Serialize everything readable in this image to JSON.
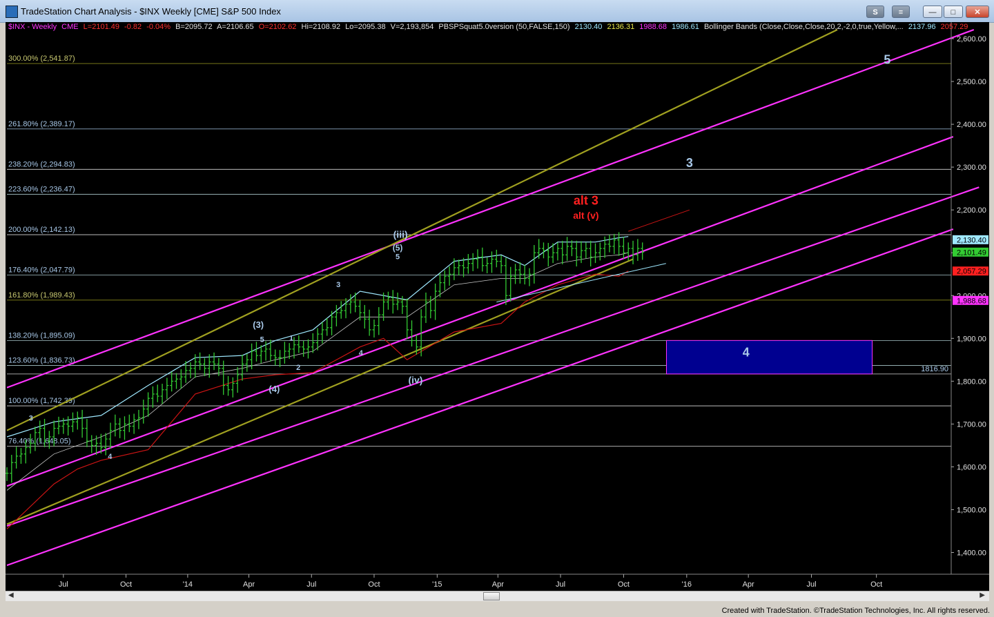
{
  "window": {
    "title": "TradeStation Chart Analysis - $INX Weekly [CME] S&P 500 Index",
    "btn_s": "S",
    "btn_menu": "≡",
    "btn_min": "—",
    "btn_max": "□",
    "btn_close": "✕"
  },
  "legend": {
    "symbol": "$INX - Weekly",
    "exchange": "CME",
    "last": "L=2101.49",
    "change": "-0.82",
    "change_pct": "-0.04%",
    "bid": "B=2095.72",
    "ask": "A=2106.65",
    "open": "O=2102.62",
    "high": "Hi=2108.92",
    "low": "Lo=2095.38",
    "volume": "V=2,193,854",
    "indicator1": "PBSPSquat5.0version (50,FALSE,150)",
    "ind1_v1": "2130.40",
    "ind1_v2": "2136.31",
    "ind1_v3": "1988.68",
    "ind1_v4": "1986.61",
    "indicator2": "Bollinger Bands (Close,Close,Close,20,2,-2,0,true,Yellow,...",
    "ind2_v1": "2137.96",
    "ind2_v2": "2057.29"
  },
  "colors": {
    "price_bars": "#33cc33",
    "magenta_channel": "#ff33ff",
    "olive_channel": "#a0a020",
    "fib_lines": "#c8ecf0",
    "wave_labels": "#a8c8e8",
    "alt_labels": "#ff2020",
    "box_fill": "#000090",
    "boll_upper": "#9fe8ff",
    "boll_mid": "#c8c8c8",
    "boll_lower": "#cc1414"
  },
  "chart_data": {
    "type": "ohlc",
    "title": "$INX Weekly [CME] S&P 500 Index",
    "y_axis_ticks": [
      "2,600.00",
      "2,500.00",
      "2,400.00",
      "2,300.00",
      "2,200.00",
      "2,100.00",
      "2,000.00",
      "1,900.00",
      "1,800.00",
      "1,700.00",
      "1,600.00",
      "1,500.00",
      "1,400.00"
    ],
    "x_axis_ticks": [
      "Jul",
      "Oct",
      "'14",
      "Apr",
      "Jul",
      "Oct",
      "'15",
      "Apr",
      "Jul",
      "Oct",
      "'16",
      "Apr",
      "Jul",
      "Oct"
    ],
    "ylim": [
      1380,
      2630
    ],
    "fib_levels": [
      {
        "label": "300.00% (2,541.87)",
        "value": 2541.87
      },
      {
        "label": "261.80% (2,389.17)",
        "value": 2389.17
      },
      {
        "label": "238.20% (2,294.83)",
        "value": 2294.83
      },
      {
        "label": "223.60% (2,236.47)",
        "value": 2236.47
      },
      {
        "label": "200.00% (2,142.13)",
        "value": 2142.13
      },
      {
        "label": "176.40% (2,047.79)",
        "value": 2047.79
      },
      {
        "label": "161.80% (1,989.43)",
        "value": 1989.43
      },
      {
        "label": "138.20% (1,895.09)",
        "value": 1895.09
      },
      {
        "label": "123.60% (1,836.73)",
        "value": 1836.73
      },
      {
        "label": "100.00% (1,742.39)",
        "value": 1742.39
      },
      {
        "label": "76.40% (1,648.05)",
        "value": 1648.05
      }
    ],
    "extra_level": {
      "label": "1816.90",
      "value": 1816.9
    },
    "right_axis_badges": [
      {
        "label": "2,130.40",
        "value": 2130.4,
        "color": "#9fe8ff"
      },
      {
        "label": "2,101.49",
        "value": 2101.49,
        "color": "#33cc33"
      },
      {
        "label": "2,057.29",
        "value": 2057.29,
        "color": "#ff2020"
      },
      {
        "label": "1,988.68",
        "value": 1988.68,
        "color": "#ff33ff"
      }
    ],
    "wave_labels": [
      {
        "text": "5",
        "x_week": 187,
        "y": 2541,
        "size": 18,
        "color": "#a8c8e8"
      },
      {
        "text": "3",
        "x_week": 145,
        "y": 2300,
        "size": 18,
        "color": "#a8c8e8"
      },
      {
        "text": "alt 3",
        "x_week": 123,
        "y": 2212,
        "size": 18,
        "color": "#ff2020"
      },
      {
        "text": "alt (v)",
        "x_week": 123,
        "y": 2179,
        "size": 14,
        "color": "#ff2020"
      },
      {
        "text": "(iii)",
        "x_week": 83.6,
        "y": 2135,
        "size": 14,
        "color": "#a8c8e8"
      },
      {
        "text": "(5)",
        "x_week": 83,
        "y": 2105,
        "size": 12,
        "color": "#a8c8e8"
      },
      {
        "text": "5",
        "x_week": 83,
        "y": 2085,
        "size": 11,
        "color": "#a8c8e8"
      },
      {
        "text": "3",
        "x_week": 70.4,
        "y": 2020,
        "size": 11,
        "color": "#a8c8e8"
      },
      {
        "text": "(3)",
        "x_week": 53.4,
        "y": 1925,
        "size": 13,
        "color": "#a8c8e8"
      },
      {
        "text": "5",
        "x_week": 54.2,
        "y": 1892,
        "size": 11,
        "color": "#a8c8e8"
      },
      {
        "text": "1",
        "x_week": 60.4,
        "y": 1895,
        "size": 11,
        "color": "#a8c8e8"
      },
      {
        "text": "4",
        "x_week": 75.2,
        "y": 1860,
        "size": 11,
        "color": "#a8c8e8"
      },
      {
        "text": "2",
        "x_week": 61.9,
        "y": 1826,
        "size": 11,
        "color": "#a8c8e8"
      },
      {
        "text": "(4)",
        "x_week": 56.8,
        "y": 1775,
        "size": 13,
        "color": "#a8c8e8"
      },
      {
        "text": "(iv)",
        "x_week": 86.8,
        "y": 1795,
        "size": 14,
        "color": "#a8c8e8"
      },
      {
        "text": "3",
        "x_week": 5.1,
        "y": 1708,
        "size": 11,
        "color": "#a8c8e8"
      },
      {
        "text": "4",
        "x_week": 21.9,
        "y": 1618,
        "size": 11,
        "color": "#a8c8e8"
      },
      {
        "text": "4",
        "x_week": 157,
        "y": 1858,
        "size": 18,
        "color": "#a8c8e8"
      }
    ],
    "target_box": {
      "x0_week": 140.1,
      "x1_week": 183.8,
      "y_top": 1895.09,
      "y_bottom": 1816.9
    },
    "channels": [
      {
        "color": "#ff33ff",
        "x0_week": 0,
        "y0": 1785,
        "x1_week": 205.4,
        "y1": 2621
      },
      {
        "color": "#ff33ff",
        "x0_week": 0,
        "y0": 1555,
        "x1_week": 201,
        "y1": 2371
      },
      {
        "color": "#ff33ff",
        "x0_week": 0,
        "y0": 1462,
        "x1_week": 206.5,
        "y1": 2253
      },
      {
        "color": "#ff33ff",
        "x0_week": 0,
        "y0": 1370,
        "x1_week": 201,
        "y1": 2155
      },
      {
        "color": "#a0a020",
        "x0_week": 0,
        "y0": 1685,
        "x1_week": 176.4,
        "y1": 2621
      },
      {
        "color": "#a0a020",
        "x0_week": 0,
        "y0": 1466,
        "x1_week": 133,
        "y1": 2085
      }
    ],
    "bars_weekly": {
      "start_week": 0,
      "closes": [
        1585,
        1610,
        1625,
        1630,
        1645,
        1655,
        1680,
        1690,
        1660,
        1670,
        1690,
        1695,
        1700,
        1695,
        1705,
        1715,
        1690,
        1660,
        1650,
        1655,
        1645,
        1665,
        1685,
        1700,
        1685,
        1700,
        1695,
        1710,
        1715,
        1735,
        1760,
        1770,
        1765,
        1780,
        1790,
        1800,
        1805,
        1810,
        1825,
        1830,
        1845,
        1840,
        1830,
        1845,
        1840,
        1830,
        1790,
        1780,
        1795,
        1815,
        1840,
        1850,
        1870,
        1860,
        1870,
        1875,
        1860,
        1855,
        1855,
        1870,
        1875,
        1885,
        1880,
        1875,
        1880,
        1890,
        1910,
        1920,
        1925,
        1950,
        1960,
        1965,
        1980,
        1985,
        1975,
        1960,
        1945,
        1920,
        1930,
        1955,
        1985,
        1995,
        1980,
        1985,
        1975,
        1920,
        1895,
        1880,
        1950,
        1985,
        1965,
        2010,
        2030,
        2045,
        2050,
        2065,
        2070,
        2065,
        2075,
        2085,
        2090,
        2070,
        2075,
        2085,
        2080,
        2070,
        2000,
        2045,
        2060,
        2050,
        2040,
        2050,
        2100,
        2110,
        2105,
        2090,
        2100,
        2110,
        2095,
        2115,
        2110,
        2090,
        2105,
        2110,
        2090,
        2100,
        2110,
        2120,
        2115,
        2130,
        2115,
        2100,
        2110,
        2095,
        2110,
        2101.49
      ]
    },
    "bollinger": {
      "upper_knots": [
        [
          0,
          1670
        ],
        [
          10,
          1705
        ],
        [
          20,
          1720
        ],
        [
          30,
          1790
        ],
        [
          40,
          1855
        ],
        [
          50,
          1860
        ],
        [
          57,
          1895
        ],
        [
          65,
          1920
        ],
        [
          75,
          2010
        ],
        [
          85,
          1990
        ],
        [
          95,
          2080
        ],
        [
          105,
          2095
        ],
        [
          110,
          2070
        ],
        [
          117,
          2125
        ],
        [
          125,
          2125
        ],
        [
          130,
          2135
        ],
        [
          132,
          2137.96
        ]
      ],
      "mid_knots": [
        [
          0,
          1545
        ],
        [
          10,
          1630
        ],
        [
          20,
          1670
        ],
        [
          30,
          1720
        ],
        [
          40,
          1810
        ],
        [
          50,
          1830
        ],
        [
          57,
          1850
        ],
        [
          65,
          1870
        ],
        [
          75,
          1950
        ],
        [
          85,
          1950
        ],
        [
          95,
          2025
        ],
        [
          105,
          2040
        ],
        [
          110,
          2040
        ],
        [
          117,
          2075
        ],
        [
          125,
          2090
        ],
        [
          130,
          2095
        ],
        [
          132,
          2100
        ]
      ],
      "lower_knots": [
        [
          0,
          1455
        ],
        [
          10,
          1560
        ],
        [
          15,
          1595
        ],
        [
          20,
          1615
        ],
        [
          30,
          1640
        ],
        [
          40,
          1770
        ],
        [
          50,
          1805
        ],
        [
          57,
          1815
        ],
        [
          65,
          1820
        ],
        [
          75,
          1880
        ],
        [
          80,
          1900
        ],
        [
          85,
          1850
        ],
        [
          95,
          1915
        ],
        [
          105,
          1935
        ],
        [
          110,
          1985
        ],
        [
          117,
          2025
        ],
        [
          125,
          2050
        ],
        [
          130,
          2045
        ],
        [
          132,
          2057.29
        ]
      ],
      "red_ext": [
        [
          132,
          2150
        ],
        [
          145,
          2200
        ]
      ],
      "cyan_ext": [
        [
          104,
          1985
        ],
        [
          140,
          2075
        ]
      ]
    }
  },
  "footer": {
    "text": "Created with TradeStation. ©TradeStation Technologies, Inc. All rights reserved."
  }
}
